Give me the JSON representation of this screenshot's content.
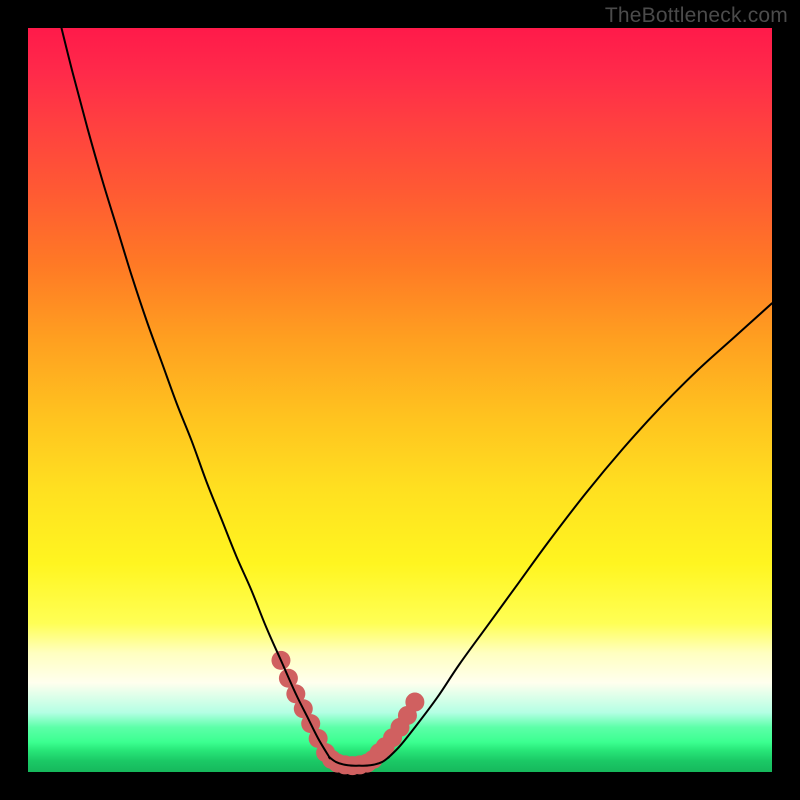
{
  "watermark": "TheBottleneck.com",
  "colors": {
    "curve": "#000000",
    "marker": "#d06060"
  },
  "chart_data": {
    "type": "line",
    "title": "",
    "xlabel": "",
    "ylabel": "",
    "xlim": [
      0,
      100
    ],
    "ylim": [
      0,
      100
    ],
    "grid": false,
    "legend": false,
    "note": "V-shaped bottleneck curve on a vertical rainbow gradient. No axes or tick labels are visible; values are estimated normalized percentages where y=0 is the bottom (green/optimal) and y=100 is the top (red).",
    "series": [
      {
        "name": "left-branch",
        "x": [
          4.5,
          6,
          8,
          10,
          12,
          14,
          16,
          18,
          20,
          22,
          24,
          26,
          28,
          30,
          32,
          34,
          36,
          37.5,
          39,
          40.5
        ],
        "y": [
          100,
          94,
          86.5,
          79.5,
          73,
          66.5,
          60.5,
          55,
          49.5,
          44.5,
          39,
          34,
          29,
          24.5,
          19.5,
          15,
          10.5,
          7.5,
          4.5,
          2
        ]
      },
      {
        "name": "valley-flat",
        "x": [
          40.5,
          41.5,
          43,
          44.5,
          46,
          47.5,
          48.5
        ],
        "y": [
          2,
          1.3,
          0.9,
          0.85,
          0.9,
          1.3,
          2
        ]
      },
      {
        "name": "right-branch",
        "x": [
          48.5,
          50,
          52,
          55,
          58,
          62,
          66,
          70,
          75,
          80,
          85,
          90,
          95,
          100
        ],
        "y": [
          2,
          3.5,
          6,
          10,
          14.5,
          20,
          25.5,
          31,
          37.5,
          43.5,
          49,
          54,
          58.5,
          63
        ]
      }
    ],
    "marker_region": {
      "name": "optimal-zone",
      "x": [
        34,
        35,
        36,
        37,
        38,
        39,
        40,
        40.8,
        41.6,
        42.6,
        43.6,
        44.6,
        45.6,
        46.4,
        47.2,
        48,
        49,
        50,
        51,
        52
      ],
      "y": [
        15,
        12.6,
        10.5,
        8.5,
        6.5,
        4.5,
        2.6,
        1.7,
        1.2,
        0.95,
        0.85,
        0.95,
        1.2,
        1.7,
        2.6,
        3.4,
        4.6,
        6,
        7.6,
        9.4
      ]
    }
  }
}
